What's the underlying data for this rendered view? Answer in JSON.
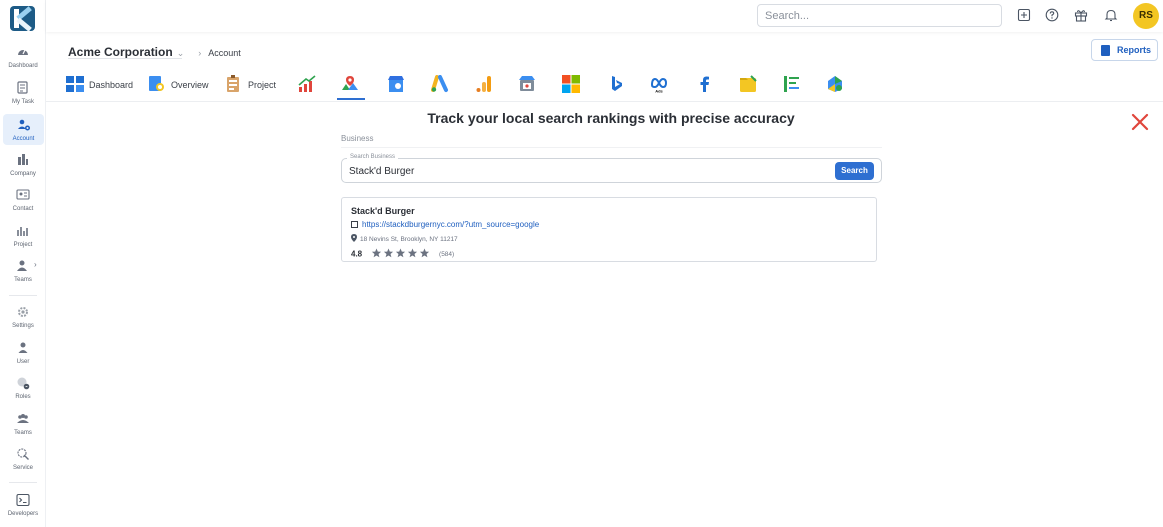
{
  "sidebar": {
    "items": [
      {
        "label": "Dashboard",
        "icon": "gauge-icon"
      },
      {
        "label": "My Task",
        "icon": "task-icon"
      },
      {
        "label": "Account",
        "icon": "account-icon",
        "active": true
      },
      {
        "label": "Company",
        "icon": "company-icon"
      },
      {
        "label": "Contact",
        "icon": "contact-icon"
      },
      {
        "label": "Project",
        "icon": "project-icon"
      },
      {
        "label": "Teams",
        "icon": "teams-icon"
      },
      {
        "label": "Settings",
        "icon": "settings-icon"
      },
      {
        "label": "User",
        "icon": "user-icon"
      },
      {
        "label": "Roles",
        "icon": "roles-icon"
      },
      {
        "label": "Teams",
        "icon": "teams-group-icon"
      },
      {
        "label": "Service",
        "icon": "service-icon"
      },
      {
        "label": "Developers",
        "icon": "terminal-icon"
      }
    ]
  },
  "topbar": {
    "search_placeholder": "Search...",
    "avatar_initials": "RS"
  },
  "breadcrumb": {
    "company": "Acme Corporation",
    "page": "Account"
  },
  "reports_label": "Reports",
  "tabs": [
    {
      "label": "Dashboard",
      "icon": "dashboard-grid-icon"
    },
    {
      "label": "Overview",
      "icon": "overview-icon"
    },
    {
      "label": "Project",
      "icon": "project-board-icon"
    },
    {
      "icon": "growth-chart-icon"
    },
    {
      "icon": "local-map-icon",
      "active": true
    },
    {
      "icon": "google-business-icon"
    },
    {
      "icon": "google-ads-icon"
    },
    {
      "icon": "google-analytics-icon"
    },
    {
      "icon": "store-icon"
    },
    {
      "icon": "microsoft-icon"
    },
    {
      "icon": "bing-icon"
    },
    {
      "icon": "meta-ads-icon"
    },
    {
      "icon": "facebook-icon"
    },
    {
      "icon": "folder-icon"
    },
    {
      "icon": "sheet-list-icon"
    },
    {
      "icon": "map-puzzle-icon"
    }
  ],
  "main": {
    "title": "Track your local search rankings with precise accuracy",
    "section_label": "Business",
    "search": {
      "legend": "Search Business",
      "value": "Stack'd Burger",
      "button_label": "Search"
    },
    "result": {
      "name": "Stack'd Burger",
      "url": "https://stackdburgernyc.com/?utm_source=google",
      "address": "18 Nevins St, Brooklyn, NY 11217",
      "rating": "4.8",
      "rating_value": 4.8,
      "review_count": "(584)"
    }
  },
  "colors": {
    "accent": "#2e6fd1",
    "active_bg": "#e6effb",
    "close": "#e0463c",
    "avatar": "#f3c623"
  }
}
